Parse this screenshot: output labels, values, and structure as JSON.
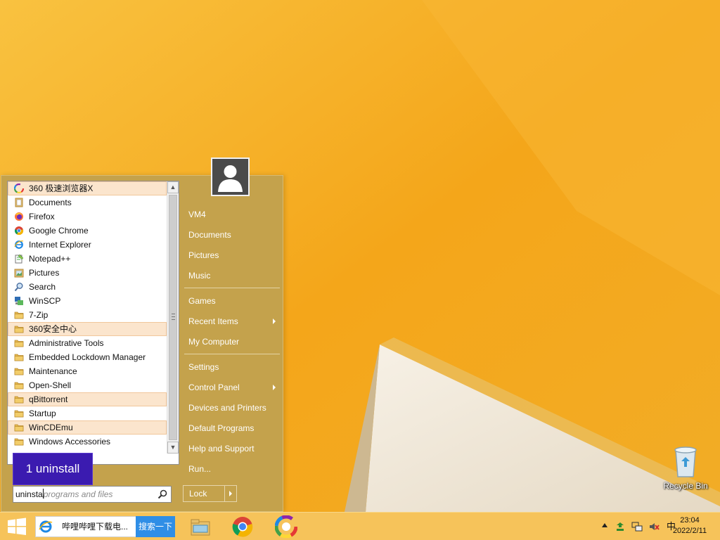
{
  "start_menu": {
    "programs": [
      {
        "label": "360 极速浏览器X",
        "icon": "360-browser-icon",
        "highlighted": true
      },
      {
        "label": "Documents",
        "icon": "documents-icon",
        "highlighted": false
      },
      {
        "label": "Firefox",
        "icon": "firefox-icon",
        "highlighted": false
      },
      {
        "label": "Google Chrome",
        "icon": "chrome-icon",
        "highlighted": false
      },
      {
        "label": "Internet Explorer",
        "icon": "ie-icon",
        "highlighted": false
      },
      {
        "label": "Notepad++",
        "icon": "notepad-icon",
        "highlighted": false
      },
      {
        "label": "Pictures",
        "icon": "pictures-icon",
        "highlighted": false
      },
      {
        "label": "Search",
        "icon": "search-icon",
        "highlighted": false
      },
      {
        "label": "WinSCP",
        "icon": "winscp-icon",
        "highlighted": false
      },
      {
        "label": "7-Zip",
        "icon": "folder-icon",
        "highlighted": false
      },
      {
        "label": "360安全中心",
        "icon": "folder-icon",
        "highlighted": true
      },
      {
        "label": "Administrative Tools",
        "icon": "folder-icon",
        "highlighted": false
      },
      {
        "label": "Embedded Lockdown Manager",
        "icon": "folder-icon",
        "highlighted": false
      },
      {
        "label": "Maintenance",
        "icon": "folder-icon",
        "highlighted": false
      },
      {
        "label": "Open-Shell",
        "icon": "folder-icon",
        "highlighted": false
      },
      {
        "label": "qBittorrent",
        "icon": "folder-icon",
        "highlighted": true
      },
      {
        "label": "Startup",
        "icon": "folder-icon",
        "highlighted": false
      },
      {
        "label": "WinCDEmu",
        "icon": "folder-icon",
        "highlighted": true
      },
      {
        "label": "Windows Accessories",
        "icon": "folder-icon",
        "highlighted": false
      }
    ],
    "tile_label": "1 uninstall",
    "search": {
      "typed": "uninsta",
      "placeholder": "programs and files"
    },
    "right": {
      "user": "VM4",
      "items_group1": [
        "Documents",
        "Pictures",
        "Music"
      ],
      "items_group2": [
        {
          "label": "Games",
          "submenu": false
        },
        {
          "label": "Recent Items",
          "submenu": true
        },
        {
          "label": "My Computer",
          "submenu": false
        }
      ],
      "items_group3": [
        {
          "label": "Settings",
          "submenu": false
        },
        {
          "label": "Control Panel",
          "submenu": true
        },
        {
          "label": "Devices and Printers",
          "submenu": false
        },
        {
          "label": "Default Programs",
          "submenu": false
        },
        {
          "label": "Help and Support",
          "submenu": false
        },
        {
          "label": "Run...",
          "submenu": false
        }
      ],
      "lock_label": "Lock"
    }
  },
  "desktop": {
    "recycle_bin_label": "Recycle Bin"
  },
  "taskbar": {
    "address_text": "哔哩哔哩下载电...",
    "search_button": "搜索一下",
    "apps": [
      "file-explorer-icon",
      "chrome-icon",
      "360-browser-icon"
    ],
    "tray": {
      "ime": "中",
      "time": "23:04",
      "date": "2022/2/11"
    }
  },
  "colors": {
    "menu_bg": "#c4a24c",
    "wallpaper": "#f4a81b",
    "tile": "#3b1bb0",
    "highlight": "#fbe5cd"
  }
}
